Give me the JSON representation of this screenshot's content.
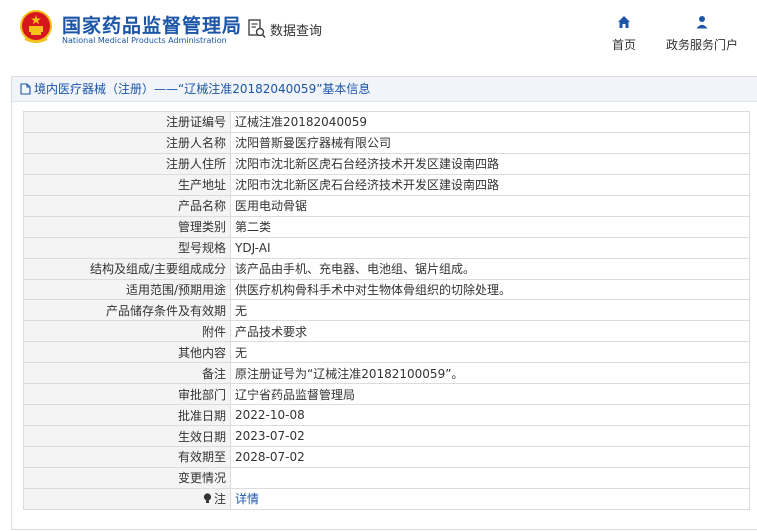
{
  "header": {
    "brand_cn": "国家药品监督管理局",
    "brand_en": "National Medical Products Administration",
    "data_query": "数据查询",
    "nav": {
      "home": "首页",
      "service": "政务服务门户"
    },
    "colors": {
      "brand": "#1c56a8",
      "emblem_red": "#d7161e",
      "emblem_gold": "#f3c11a"
    }
  },
  "panel": {
    "title": "境内医疗器械（注册）——“辽械注准20182040059”基本信息"
  },
  "rows": [
    {
      "label": "注册证编号",
      "value": "辽械注准20182040059"
    },
    {
      "label": "注册人名称",
      "value": "沈阳普斯曼医疗器械有限公司"
    },
    {
      "label": "注册人住所",
      "value": "沈阳市沈北新区虎石台经济技术开发区建设南四路"
    },
    {
      "label": "生产地址",
      "value": "沈阳市沈北新区虎石台经济技术开发区建设南四路"
    },
    {
      "label": "产品名称",
      "value": "医用电动骨锯"
    },
    {
      "label": "管理类别",
      "value": "第二类"
    },
    {
      "label": "型号规格",
      "value": "YDJ-AⅠ"
    },
    {
      "label": "结构及组成/主要组成成分",
      "value": "该产品由手机、充电器、电池组、锯片组成。"
    },
    {
      "label": "适用范围/预期用途",
      "value": "供医疗机构骨科手术中对生物体骨组织的切除处理。"
    },
    {
      "label": "产品储存条件及有效期",
      "value": "无"
    },
    {
      "label": "附件",
      "value": "产品技术要求"
    },
    {
      "label": "其他内容",
      "value": "无"
    },
    {
      "label": "备注",
      "value": "原注册证号为“辽械注准20182100059”。"
    },
    {
      "label": "审批部门",
      "value": "辽宁省药品监督管理局"
    },
    {
      "label": "批准日期",
      "value": "2022-10-08"
    },
    {
      "label": "生效日期",
      "value": "2023-07-02"
    },
    {
      "label": "有效期至",
      "value": "2028-07-02"
    },
    {
      "label": "变更情况",
      "value": ""
    }
  ],
  "note_row": {
    "label": "注",
    "value": "详情",
    "icon": "lightbulb-icon"
  }
}
